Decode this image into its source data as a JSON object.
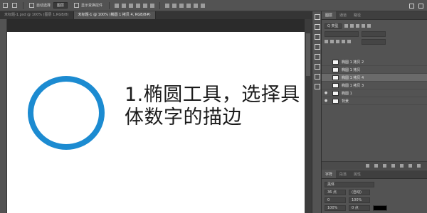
{
  "options_bar": {
    "auto_select_label": "自动选择",
    "auto_select_value": "图层",
    "transform_label": "显示变换控件"
  },
  "doc_tabs": [
    {
      "label": "未标题-1.psd @ 100% (图层 1,RGB/8)"
    },
    {
      "label": "未标题-1 @ 100% (椭圆 1 拷贝 4, RGB/8#)"
    }
  ],
  "canvas": {
    "headline": "1.椭圆工具，选择具体数字的描边",
    "ring_color": "#1c8bd1",
    "text_color": "#1b1b1b",
    "background": "#ffffff"
  },
  "panel": {
    "tabs": [
      "图层",
      "通道",
      "路径"
    ],
    "kind_label": "Q 类型",
    "layers": [
      {
        "name": "椭圆 1 拷贝 2",
        "visible": false,
        "selected": false
      },
      {
        "name": "椭圆 1 拷贝",
        "visible": false,
        "selected": false
      },
      {
        "name": "椭圆 1 拷贝 4",
        "visible": false,
        "selected": true
      },
      {
        "name": "椭圆 1 拷贝 3",
        "visible": false,
        "selected": false
      },
      {
        "name": "椭圆 1",
        "visible": true,
        "selected": false
      },
      {
        "name": "背景",
        "visible": true,
        "selected": false
      }
    ]
  },
  "char_panel": {
    "tabs": [
      "字符",
      "段落",
      "属性"
    ],
    "font": "黑体",
    "size": "36 点",
    "leading": "(自动)",
    "tracking": "0",
    "scale_v": "100%",
    "scale_h": "100%",
    "baseline": "0 点"
  }
}
